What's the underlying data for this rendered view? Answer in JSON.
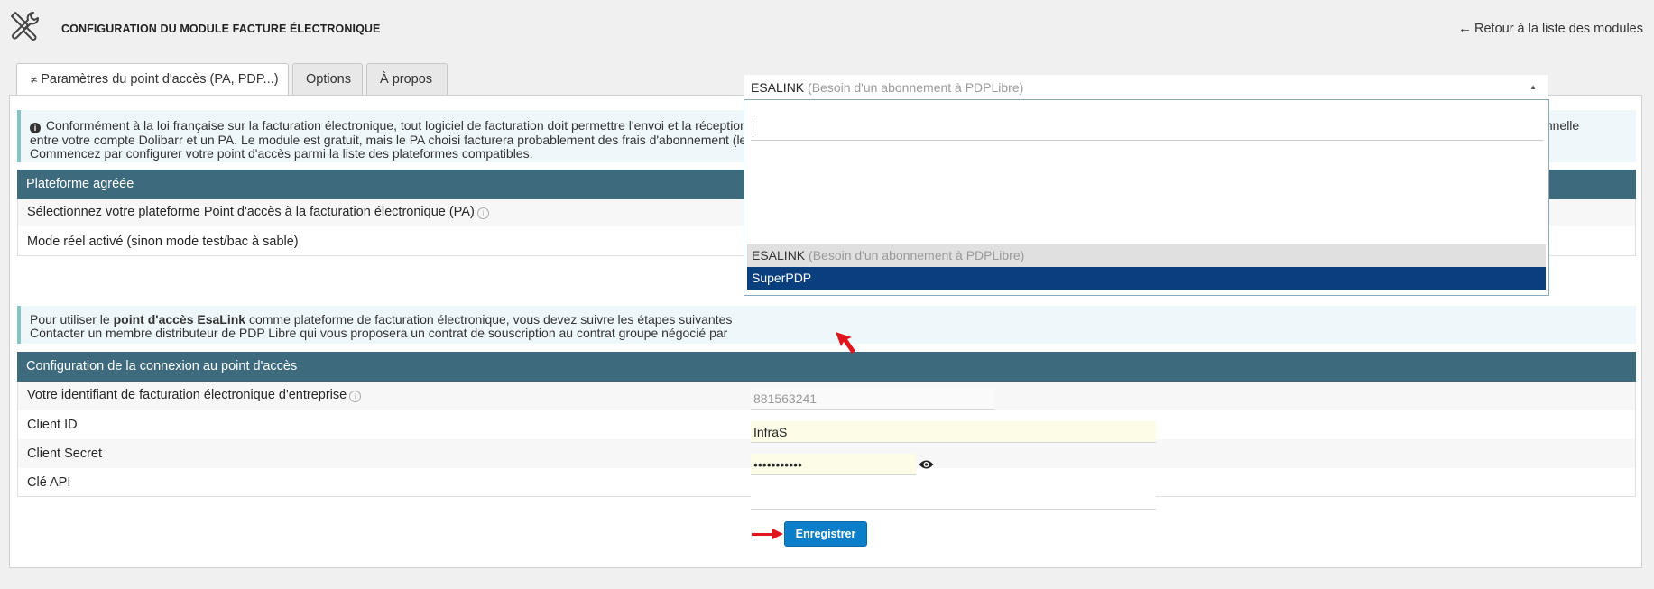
{
  "header": {
    "title": "CONFIGURATION DU MODULE FACTURE ÉLECTRONIQUE",
    "back_label": "Retour à la liste des modules",
    "back_arrow": "←"
  },
  "tabs": [
    {
      "label": "Paramètres du point d'accès (PA, PDP...)",
      "icon": "≭",
      "active": true
    },
    {
      "label": "Options",
      "active": false
    },
    {
      "label": "À propos",
      "active": false
    }
  ],
  "info1": {
    "icon": "i",
    "line1": "Conformément à la loi française sur la facturation électronique, tout logiciel de facturation doit permettre l'envoi et la réception de factures. Ceci s'effectue par le biais d'un partenaire privé agréé (PA, anciennement PDP). Ce module permet une synchronisation bidirectionnelle",
    "line2": "entre votre compte Dolibarr et un PA. Le module est gratuit, mais le PA choisi facturera probablement des frais d'abonnement (le contrat est établi directement avec le PA).",
    "line3": "Commencez par configurer votre point d'accès parmi la liste des plateformes compatibles."
  },
  "section1": {
    "title": "Plateforme agréée",
    "rows": [
      {
        "label": "Sélectionnez votre plateforme Point d'accès à la facturation électronique (PA)"
      },
      {
        "label": "Mode réel activé (sinon mode test/bac à sable)"
      }
    ]
  },
  "select": {
    "value": "ESALINK",
    "hint": "(Besoin d'un abonnement à PDPLibre)",
    "caret": "▲"
  },
  "dropdown": {
    "search_value": "",
    "options": [
      {
        "label": "ESALINK",
        "hint": "(Besoin d'un abonnement à PDPLibre)"
      },
      {
        "label": "SuperPDP",
        "hint": ""
      }
    ]
  },
  "info2": {
    "prefix": "Pour utiliser le ",
    "bold": "point d'accès EsaLink",
    "suffix": " comme plateforme de facturation électronique, vous devez suivre les étapes suivantes",
    "line2": "Contacter un membre distributeur de PDP Libre qui vous proposera un contrat de souscription au contrat groupe négocié par"
  },
  "section2": {
    "title": "Configuration de la connexion au point d'accès",
    "rows": [
      {
        "label": "Votre identifiant de facturation électronique d'entreprise",
        "value": "881563241"
      },
      {
        "label": "Client ID",
        "value": "InfraS"
      },
      {
        "label": "Client Secret",
        "value": "•••••••••••"
      },
      {
        "label": "Clé API",
        "value": ""
      }
    ]
  },
  "save_label": "Enregistrer",
  "colors": {
    "section_header": "#3d6a7d",
    "dropdown_selected": "#0a3f7f",
    "save_button": "#0b7ec9",
    "annotation_arrow": "#e0161c"
  }
}
